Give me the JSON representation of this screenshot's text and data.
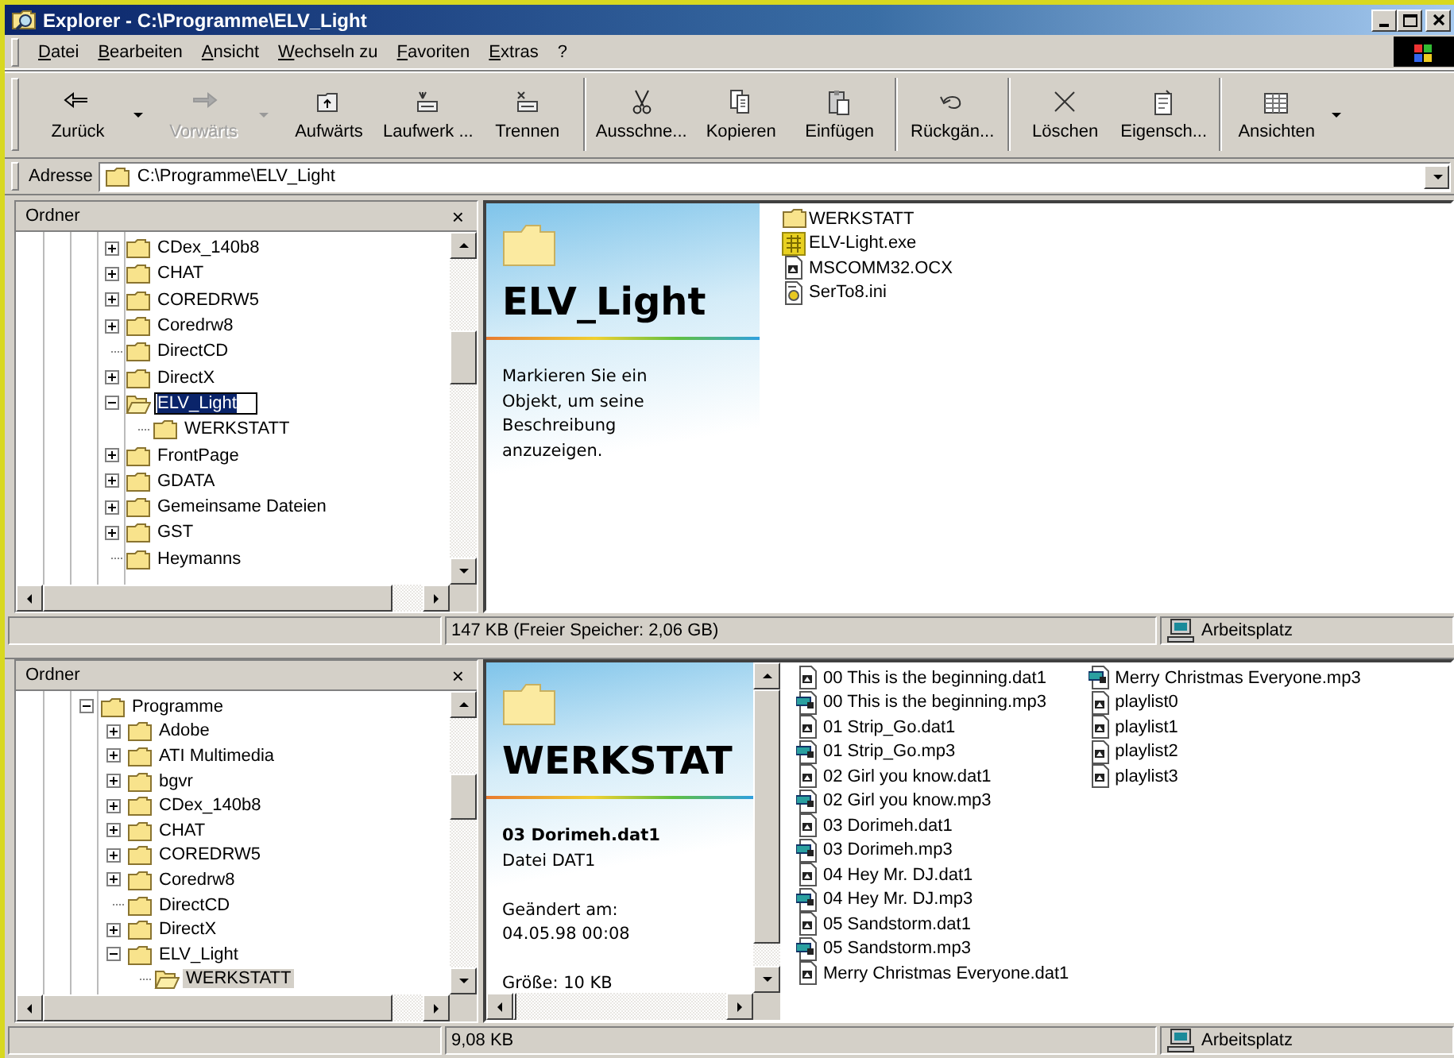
{
  "window": {
    "title": "Explorer - C:\\Programme\\ELV_Light"
  },
  "menu": [
    "Datei",
    "Bearbeiten",
    "Ansicht",
    "Wechseln zu",
    "Favoriten",
    "Extras",
    "?"
  ],
  "toolbar": [
    {
      "label": "Zurück",
      "disabled": false,
      "dropdown": true,
      "separator_before": false
    },
    {
      "label": "Vorwärts",
      "disabled": true,
      "dropdown": true,
      "separator_before": false
    },
    {
      "label": "Aufwärts",
      "disabled": false,
      "dropdown": false,
      "separator_before": false
    },
    {
      "label": "Laufwerk ...",
      "disabled": false,
      "dropdown": false,
      "separator_before": false
    },
    {
      "label": "Trennen",
      "disabled": false,
      "dropdown": false,
      "separator_before": false
    },
    {
      "label": "Ausschne...",
      "disabled": false,
      "dropdown": false,
      "separator_before": true
    },
    {
      "label": "Kopieren",
      "disabled": false,
      "dropdown": false,
      "separator_before": false
    },
    {
      "label": "Einfügen",
      "disabled": false,
      "dropdown": false,
      "separator_before": false
    },
    {
      "label": "Rückgän...",
      "disabled": false,
      "dropdown": false,
      "separator_before": true
    },
    {
      "label": "Löschen",
      "disabled": false,
      "dropdown": false,
      "separator_before": true
    },
    {
      "label": "Eigensch...",
      "disabled": false,
      "dropdown": false,
      "separator_before": false
    },
    {
      "label": "Ansichten",
      "disabled": false,
      "dropdown": true,
      "separator_before": true
    }
  ],
  "address": {
    "label": "Adresse",
    "value": "C:\\Programme\\ELV_Light"
  },
  "panes": [
    {
      "folder_pane": {
        "title": "Ordner",
        "close": "×",
        "tree": [
          {
            "label": "CDex_140b8",
            "expanded": false,
            "selected": false
          },
          {
            "label": "CHAT",
            "expanded": false,
            "selected": false
          },
          {
            "label": "COREDRW5",
            "expanded": false,
            "selected": false
          },
          {
            "label": "Coredrw8",
            "expanded": false,
            "selected": false
          },
          {
            "label": "DirectCD",
            "selected": false
          },
          {
            "label": "DirectX",
            "expanded": false,
            "selected": false
          },
          {
            "label": "ELV_Light",
            "expanded": true,
            "selected": true,
            "renaming": true,
            "children": [
              {
                "label": "WERKSTATT",
                "selected": false
              }
            ]
          },
          {
            "label": "FrontPage",
            "expanded": false,
            "selected": false
          },
          {
            "label": "GDATA",
            "expanded": false,
            "selected": false
          },
          {
            "label": "Gemeinsame Dateien",
            "expanded": false,
            "selected": false
          },
          {
            "label": "GST",
            "expanded": false,
            "selected": false
          },
          {
            "label": "Heymanns",
            "selected": false
          }
        ]
      },
      "web_view": {
        "heading": "ELV_Light",
        "info": [
          {
            "kind": "paragraph",
            "text": "Markieren Sie ein Objekt, um seine Beschreibung anzuzeigen."
          }
        ]
      },
      "files": [
        {
          "name": "WERKSTATT",
          "kind": "folder"
        },
        {
          "name": "ELV-Light.exe",
          "kind": "exe"
        },
        {
          "name": "MSCOMM32.OCX",
          "kind": "file"
        },
        {
          "name": "SerTo8.ini",
          "kind": "ini"
        }
      ],
      "status_bar": {
        "size": "147 KB (Freier Speicher: 2,06 GB)",
        "zone": "Arbeitsplatz"
      }
    },
    {
      "folder_pane": {
        "title": "Ordner",
        "close": "×",
        "tree": [
          {
            "label": "Programme",
            "expanded": true,
            "selected": false,
            "children": [
              {
                "label": "Adobe",
                "expanded": false,
                "selected": false
              },
              {
                "label": "ATI Multimedia",
                "expanded": false,
                "selected": false
              },
              {
                "label": "bgvr",
                "expanded": false,
                "selected": false
              },
              {
                "label": "CDex_140b8",
                "expanded": false,
                "selected": false
              },
              {
                "label": "CHAT",
                "expanded": false,
                "selected": false
              },
              {
                "label": "COREDRW5",
                "expanded": false,
                "selected": false
              },
              {
                "label": "Coredrw8",
                "expanded": false,
                "selected": false
              },
              {
                "label": "DirectCD",
                "selected": false
              },
              {
                "label": "DirectX",
                "expanded": false,
                "selected": false
              },
              {
                "label": "ELV_Light",
                "expanded": true,
                "selected": false,
                "children": [
                  {
                    "label": "WERKSTATT",
                    "selected": true
                  }
                ]
              }
            ]
          }
        ]
      },
      "web_view": {
        "heading": "WERKSTAT",
        "info": [
          {
            "kind": "bold",
            "text": "03 Dorimeh.dat1"
          },
          {
            "kind": "plain",
            "text": "Datei DAT1"
          },
          {
            "kind": "gap"
          },
          {
            "kind": "plain",
            "text": "Geändert am:"
          },
          {
            "kind": "plain",
            "text": "04.05.98 00:08"
          },
          {
            "kind": "gap"
          },
          {
            "kind": "plain",
            "text": "Größe: 10 KB"
          }
        ]
      },
      "files": [
        {
          "name": "00 This is the beginning.dat1",
          "kind": "file"
        },
        {
          "name": "00 This is the beginning.mp3",
          "kind": "mp3"
        },
        {
          "name": "01 Strip_Go.dat1",
          "kind": "file"
        },
        {
          "name": "01 Strip_Go.mp3",
          "kind": "mp3"
        },
        {
          "name": "02 Girl you know.dat1",
          "kind": "file"
        },
        {
          "name": "02 Girl you know.mp3",
          "kind": "mp3"
        },
        {
          "name": "03 Dorimeh.dat1",
          "kind": "file"
        },
        {
          "name": "03 Dorimeh.mp3",
          "kind": "mp3"
        },
        {
          "name": "04 Hey Mr. DJ.dat1",
          "kind": "file"
        },
        {
          "name": "04 Hey Mr. DJ.mp3",
          "kind": "mp3"
        },
        {
          "name": "05 Sandstorm.dat1",
          "kind": "file"
        },
        {
          "name": "05 Sandstorm.mp3",
          "kind": "mp3"
        },
        {
          "name": "Merry Christmas Everyone.dat1",
          "kind": "file"
        },
        {
          "name": "Merry Christmas Everyone.mp3",
          "kind": "mp3"
        },
        {
          "name": "playlist0",
          "kind": "file"
        },
        {
          "name": "playlist1",
          "kind": "file"
        },
        {
          "name": "playlist2",
          "kind": "file"
        },
        {
          "name": "playlist3",
          "kind": "file"
        }
      ],
      "status_bar": {
        "size": "9,08 KB",
        "zone": "Arbeitsplatz"
      }
    }
  ]
}
